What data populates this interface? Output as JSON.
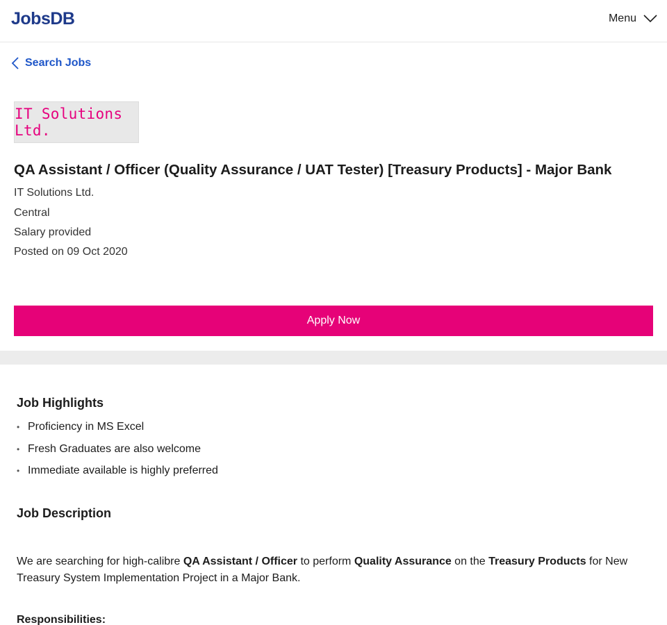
{
  "header": {
    "logo_text": "JobsDB",
    "menu_label": "Menu"
  },
  "nav": {
    "back_label": "Search Jobs"
  },
  "job": {
    "company_logo_text": "IT Solutions Ltd.",
    "title": "QA Assistant / Officer (Quality Assurance / UAT Tester) [Treasury Products] - Major Bank",
    "company": "IT Solutions Ltd.",
    "location": "Central",
    "salary": "Salary provided",
    "posted": "Posted on 09 Oct 2020",
    "apply_label": "Apply Now"
  },
  "highlights": {
    "title": "Job Highlights",
    "items": [
      "Proficiency in MS Excel",
      "Fresh Graduates are also welcome",
      "Immediate available is highly preferred"
    ]
  },
  "description": {
    "title": "Job Description",
    "p1_a": "We are searching for high-calibre ",
    "p1_b": "QA Assistant / Officer",
    "p1_c": " to perform ",
    "p1_d": "Quality Assurance",
    "p1_e": " on the ",
    "p1_f": "Treasury Products",
    "p1_g": " for New Treasury System Implementation Project in a Major Bank.",
    "responsibilities_label": "Responsibilities:"
  },
  "colors": {
    "brand": "#1e3a8a",
    "link": "#1e56c8",
    "apply": "#e60278",
    "logo_text": "#e6007e"
  }
}
